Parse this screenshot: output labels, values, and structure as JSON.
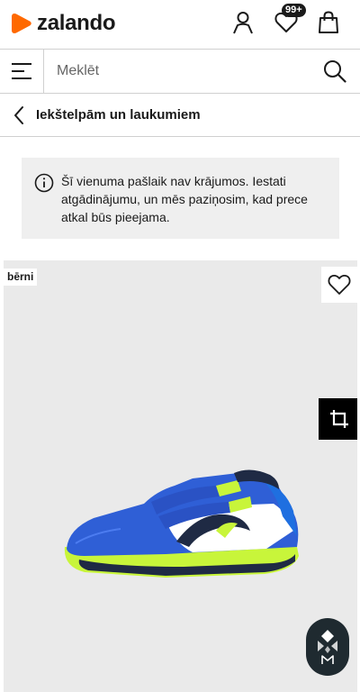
{
  "header": {
    "logo_text": "zalando",
    "wishlist_badge": "99+",
    "brand_color": "#ff6900"
  },
  "search": {
    "placeholder": "Meklēt"
  },
  "breadcrumb": {
    "label": "Iekštelpām un laukumiem"
  },
  "notice": {
    "text": "Šī vienuma pašlaik nav krājumos. Iestati atgādinājumu, un mēs paziņosim, kad prece atkal būs pieejama."
  },
  "product": {
    "tag": "bērni",
    "shoe_colors": [
      "#2f5fd6",
      "#ffffff",
      "#c8f53a",
      "#1f2a44"
    ]
  },
  "icons": {
    "user": "user-icon",
    "wishlist": "heart-icon",
    "bag": "shopping-bag-icon",
    "menu": "hamburger-menu-icon",
    "search": "search-icon",
    "back": "chevron-left-icon",
    "info": "info-icon",
    "favorite": "heart-outline-icon",
    "crop": "crop-icon",
    "assistant": "assistant-icon"
  }
}
